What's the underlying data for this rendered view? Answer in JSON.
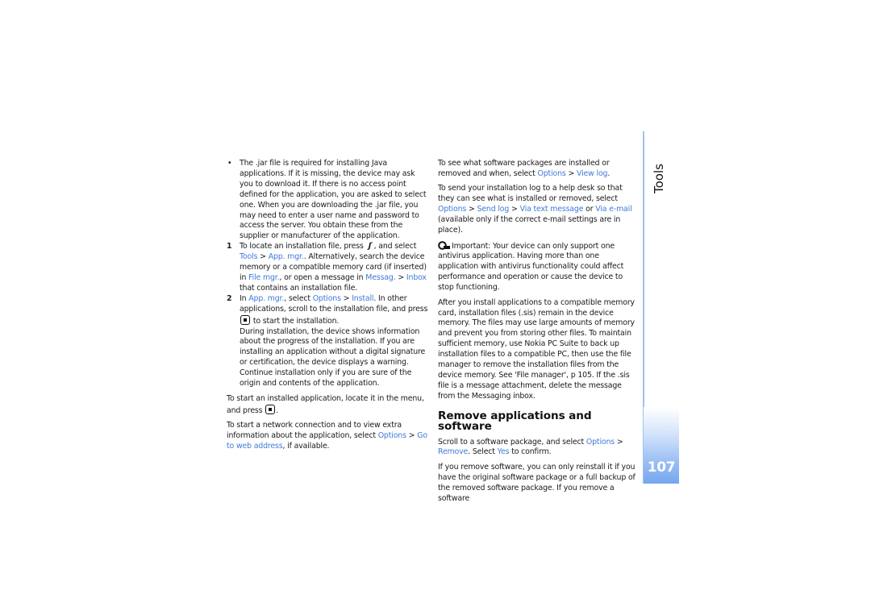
{
  "section": {
    "title": "Tools",
    "page_number": "107"
  },
  "colors": {
    "link": "#3f7bd8",
    "accent_line": "#9dc1f1",
    "tab_gradient_end": "#75a7ef"
  },
  "left_column": {
    "bullet_item": "The .jar file is required for installing Java applications. If it is missing, the device may ask you to download it. If there is no access point defined for the application, you are asked to select one. When you are downloading the .jar file, you may need to enter a user name and password to access the server. You obtain these from the supplier or manufacturer of the application.",
    "step1": {
      "number": "1",
      "t1": "To locate an installation file, press",
      "icon": "menu-key-icon",
      "t2": ", and select",
      "l1": "Tools",
      "sep1": " > ",
      "l2": "App. mgr.",
      "t3": ". Alternatively, search the device memory or a compatible memory card (if inserted) in ",
      "l3": "File mgr.",
      "t4": ", or open a message in ",
      "l4": "Messag.",
      "sep2": " > ",
      "l5": "Inbox",
      "t5": " that contains an installation file."
    },
    "step2": {
      "number": "2",
      "t1": "In ",
      "l1": "App. mgr.",
      "t2": ", select ",
      "l2": "Options",
      "sep1": " > ",
      "l3": "Install",
      "t3": ". In other applications, scroll to the installation file, and press",
      "icon": "scroll-key-icon",
      "t4": "to start the installation.",
      "note": "During installation, the device shows information about the progress of the installation. If you are installing an application without a digital signature or certification, the device displays a warning. Continue installation only if you are sure of the origin and contents of the application."
    },
    "para_start": {
      "t1": "To start an installed application, locate it in the menu, and press",
      "icon": "scroll-key-icon",
      "t2": "."
    },
    "para_network": {
      "t1": "To start a network connection and to view extra information about the application, select ",
      "l1": "Options",
      "sep1": " > ",
      "l2": "Go to web address",
      "t2": ", if available."
    }
  },
  "right_column": {
    "para_log": {
      "t1": "To see what software packages are installed or removed and when, select ",
      "l1": "Options",
      "sep1": " > ",
      "l2": "View log",
      "t2": "."
    },
    "para_send": {
      "t1": "To send your installation log to a help desk so that they can see what is installed or removed, select ",
      "l1": "Options",
      "sep1": " > ",
      "l2": "Send log",
      "sep2": " > ",
      "l3": "Via text message",
      "t2": " or ",
      "l4": "Via e-mail",
      "t3": " (available only if the correct e-mail settings are in place)."
    },
    "important": {
      "icon": "important-icon",
      "text": "Important: Your device can only support one antivirus application. Having more than one application with antivirus functionality could affect performance and operation or cause the device to stop functioning."
    },
    "para_memory": "After you install applications to a compatible memory card, installation files (.sis) remain in the device memory. The files may use large amounts of memory and prevent you from storing other files. To maintain sufficient memory, use Nokia PC Suite to back up installation files to a compatible PC, then use the file manager to remove the installation files from the device memory. See 'File manager', p 105. If the .sis file is a message attachment, delete the message from the Messaging inbox.",
    "heading": "Remove applications and software",
    "para_remove": {
      "t1": "Scroll to a software package, and select ",
      "l1": "Options",
      "sep1": " > ",
      "l2": "Remove",
      "t2": ". Select ",
      "l3": "Yes",
      "t3": " to confirm."
    },
    "para_reinstall": "If you remove software, you can only reinstall it if you have the original software package or a full backup of the removed software package. If you remove a software"
  }
}
